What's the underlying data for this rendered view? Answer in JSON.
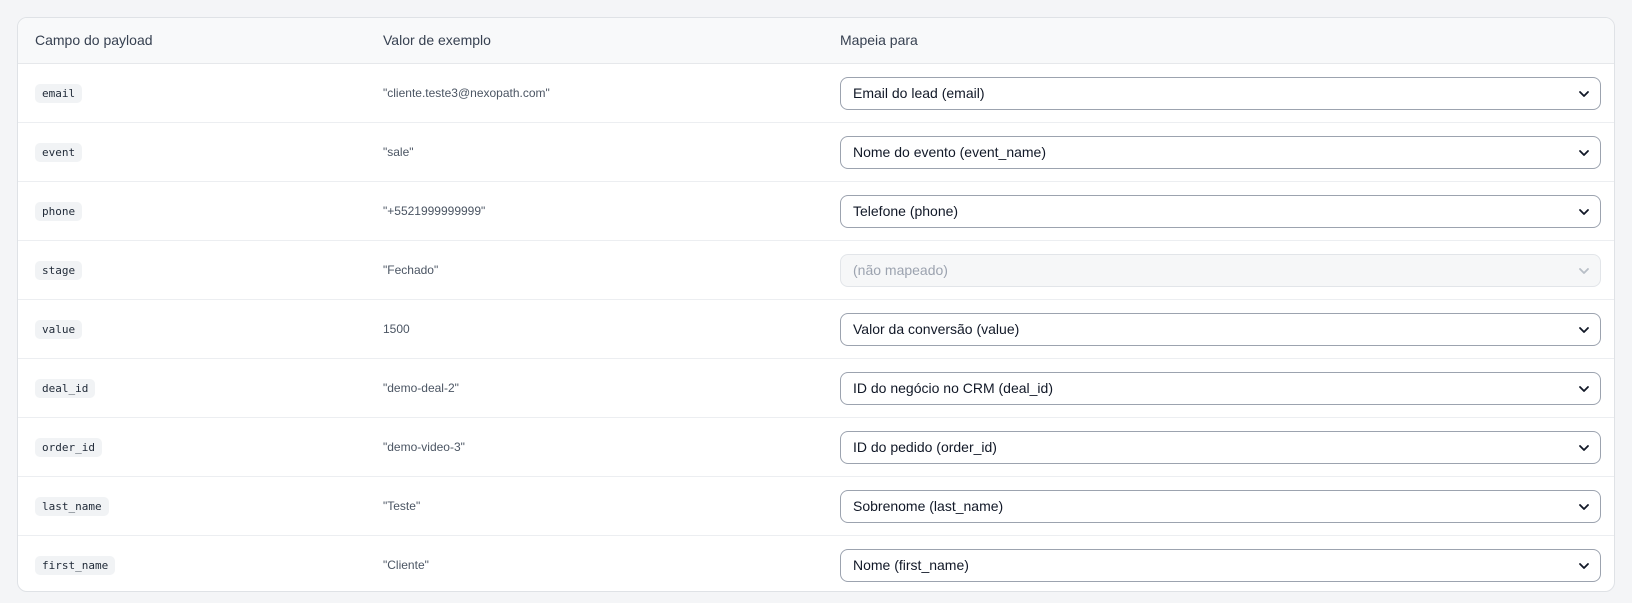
{
  "table": {
    "headers": {
      "field": "Campo do payload",
      "example": "Valor de exemplo",
      "maps_to": "Mapeia para"
    },
    "rows": [
      {
        "field": "email",
        "example": "\"cliente.teste3@nexopath.com\"",
        "maps_to": "Email do lead (email)",
        "disabled": false
      },
      {
        "field": "event",
        "example": "\"sale\"",
        "maps_to": "Nome do evento (event_name)",
        "disabled": false
      },
      {
        "field": "phone",
        "example": "\"+5521999999999\"",
        "maps_to": "Telefone (phone)",
        "disabled": false
      },
      {
        "field": "stage",
        "example": "\"Fechado\"",
        "maps_to": "(não mapeado)",
        "disabled": true
      },
      {
        "field": "value",
        "example": "1500",
        "maps_to": "Valor da conversão (value)",
        "disabled": false
      },
      {
        "field": "deal_id",
        "example": "\"demo-deal-2\"",
        "maps_to": "ID do negócio no CRM (deal_id)",
        "disabled": false
      },
      {
        "field": "order_id",
        "example": "\"demo-video-3\"",
        "maps_to": "ID do pedido (order_id)",
        "disabled": false
      },
      {
        "field": "last_name",
        "example": "\"Teste\"",
        "maps_to": "Sobrenome (last_name)",
        "disabled": false
      },
      {
        "field": "first_name",
        "example": "\"Cliente\"",
        "maps_to": "Nome (first_name)",
        "disabled": false
      }
    ]
  },
  "icons": {
    "select_chevron": "chevron-down-icon"
  },
  "colors": {
    "border": "#dfe2e6",
    "header_bg": "#f8f9fa",
    "pill_bg": "#f1f3f5",
    "disabled_text": "#9ca3af"
  }
}
